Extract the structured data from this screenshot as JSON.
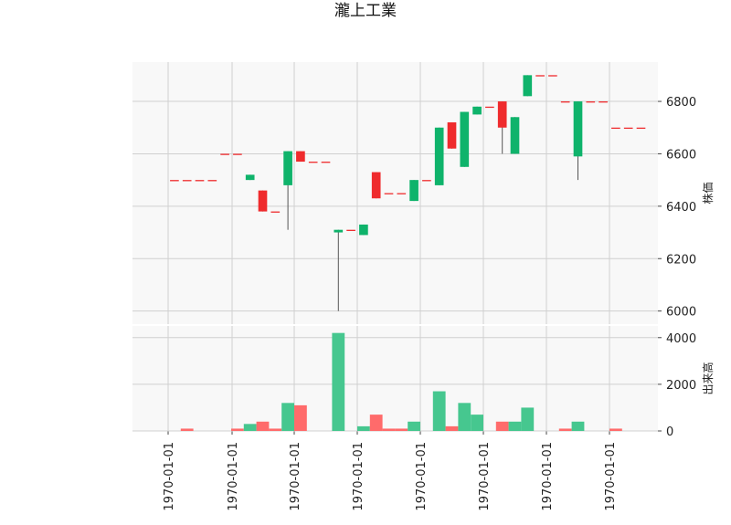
{
  "chart_data": {
    "type": "candlestick",
    "title": "瀧上工業",
    "x_tick_labels": [
      "1970-01-01",
      "1970-01-01",
      "1970-01-01",
      "1970-01-01",
      "1970-01-01",
      "1970-01-01",
      "1970-01-01",
      "1970-01-01"
    ],
    "price_panel": {
      "ylabel": "株価",
      "ylim": [
        5950,
        6950
      ],
      "yticks": [
        6000,
        6200,
        6400,
        6600,
        6800
      ],
      "grid": true
    },
    "volume_panel": {
      "ylabel": "出来高",
      "ylim": [
        0,
        4500
      ],
      "yticks": [
        0,
        2000,
        4000
      ],
      "grid": true
    },
    "colors": {
      "up": "#ef2b2d",
      "down": "#0fb36b",
      "up_volume": "#ff6b6b",
      "down_volume": "#46c78f",
      "grid": "#d0d0d0",
      "panel_bg": "#f8f8f8"
    },
    "candles": [
      {
        "o": 6500,
        "h": 6500,
        "l": 6500,
        "c": 6500,
        "v": 0
      },
      {
        "o": 6500,
        "h": 6500,
        "l": 6500,
        "c": 6500,
        "v": 100
      },
      {
        "o": 6500,
        "h": 6500,
        "l": 6500,
        "c": 6500,
        "v": 0
      },
      {
        "o": 6500,
        "h": 6500,
        "l": 6500,
        "c": 6500,
        "v": 0
      },
      {
        "o": 6600,
        "h": 6600,
        "l": 6600,
        "c": 6600,
        "v": 0
      },
      {
        "o": 6600,
        "h": 6600,
        "l": 6600,
        "c": 6600,
        "v": 100
      },
      {
        "o": 6520,
        "h": 6520,
        "l": 6500,
        "c": 6500,
        "v": 300
      },
      {
        "o": 6380,
        "h": 6460,
        "l": 6380,
        "c": 6460,
        "v": 400
      },
      {
        "o": 6380,
        "h": 6380,
        "l": 6380,
        "c": 6380,
        "v": 100
      },
      {
        "o": 6610,
        "h": 6610,
        "l": 6310,
        "c": 6480,
        "v": 1200
      },
      {
        "o": 6570,
        "h": 6610,
        "l": 6570,
        "c": 6610,
        "v": 1100
      },
      {
        "o": 6570,
        "h": 6570,
        "l": 6570,
        "c": 6570,
        "v": 0
      },
      {
        "o": 6570,
        "h": 6570,
        "l": 6570,
        "c": 6570,
        "v": 0
      },
      {
        "o": 6310,
        "h": 6310,
        "l": 6000,
        "c": 6300,
        "v": 4200
      },
      {
        "o": 6310,
        "h": 6310,
        "l": 6310,
        "c": 6310,
        "v": 0
      },
      {
        "o": 6330,
        "h": 6330,
        "l": 6290,
        "c": 6290,
        "v": 200
      },
      {
        "o": 6430,
        "h": 6530,
        "l": 6430,
        "c": 6530,
        "v": 700
      },
      {
        "o": 6450,
        "h": 6450,
        "l": 6450,
        "c": 6450,
        "v": 100
      },
      {
        "o": 6450,
        "h": 6450,
        "l": 6450,
        "c": 6450,
        "v": 100
      },
      {
        "o": 6500,
        "h": 6500,
        "l": 6420,
        "c": 6420,
        "v": 400
      },
      {
        "o": 6500,
        "h": 6500,
        "l": 6500,
        "c": 6500,
        "v": 0
      },
      {
        "o": 6700,
        "h": 6700,
        "l": 6480,
        "c": 6480,
        "v": 1700
      },
      {
        "o": 6620,
        "h": 6720,
        "l": 6620,
        "c": 6720,
        "v": 200
      },
      {
        "o": 6760,
        "h": 6760,
        "l": 6550,
        "c": 6550,
        "v": 1200
      },
      {
        "o": 6780,
        "h": 6780,
        "l": 6750,
        "c": 6750,
        "v": 700
      },
      {
        "o": 6780,
        "h": 6780,
        "l": 6780,
        "c": 6780,
        "v": 0
      },
      {
        "o": 6700,
        "h": 6800,
        "l": 6600,
        "c": 6800,
        "v": 400
      },
      {
        "o": 6740,
        "h": 6740,
        "l": 6600,
        "c": 6600,
        "v": 400
      },
      {
        "o": 6900,
        "h": 6900,
        "l": 6820,
        "c": 6820,
        "v": 1000
      },
      {
        "o": 6900,
        "h": 6900,
        "l": 6900,
        "c": 6900,
        "v": 0
      },
      {
        "o": 6900,
        "h": 6900,
        "l": 6900,
        "c": 6900,
        "v": 0
      },
      {
        "o": 6800,
        "h": 6800,
        "l": 6800,
        "c": 6800,
        "v": 100
      },
      {
        "o": 6800,
        "h": 6800,
        "l": 6500,
        "c": 6590,
        "v": 400
      },
      {
        "o": 6800,
        "h": 6800,
        "l": 6800,
        "c": 6800,
        "v": 0
      },
      {
        "o": 6800,
        "h": 6800,
        "l": 6800,
        "c": 6800,
        "v": 0
      },
      {
        "o": 6700,
        "h": 6700,
        "l": 6700,
        "c": 6700,
        "v": 100
      },
      {
        "o": 6700,
        "h": 6700,
        "l": 6700,
        "c": 6700,
        "v": 0
      },
      {
        "o": 6700,
        "h": 6700,
        "l": 6700,
        "c": 6700,
        "v": 0
      }
    ]
  }
}
